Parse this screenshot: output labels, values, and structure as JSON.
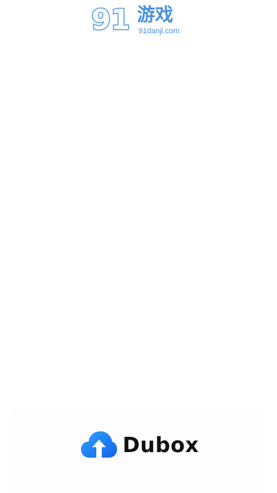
{
  "watermark": {
    "numeral": "91",
    "chinese": "游戏",
    "site": "91danji.com",
    "color": "#5c9fe6"
  },
  "splash": {
    "app_name": "Dubox",
    "logo_icon": "cloud-upload-icon",
    "brand_color": "#1f74f5",
    "text_color": "#111111",
    "background": "#ffffff"
  }
}
